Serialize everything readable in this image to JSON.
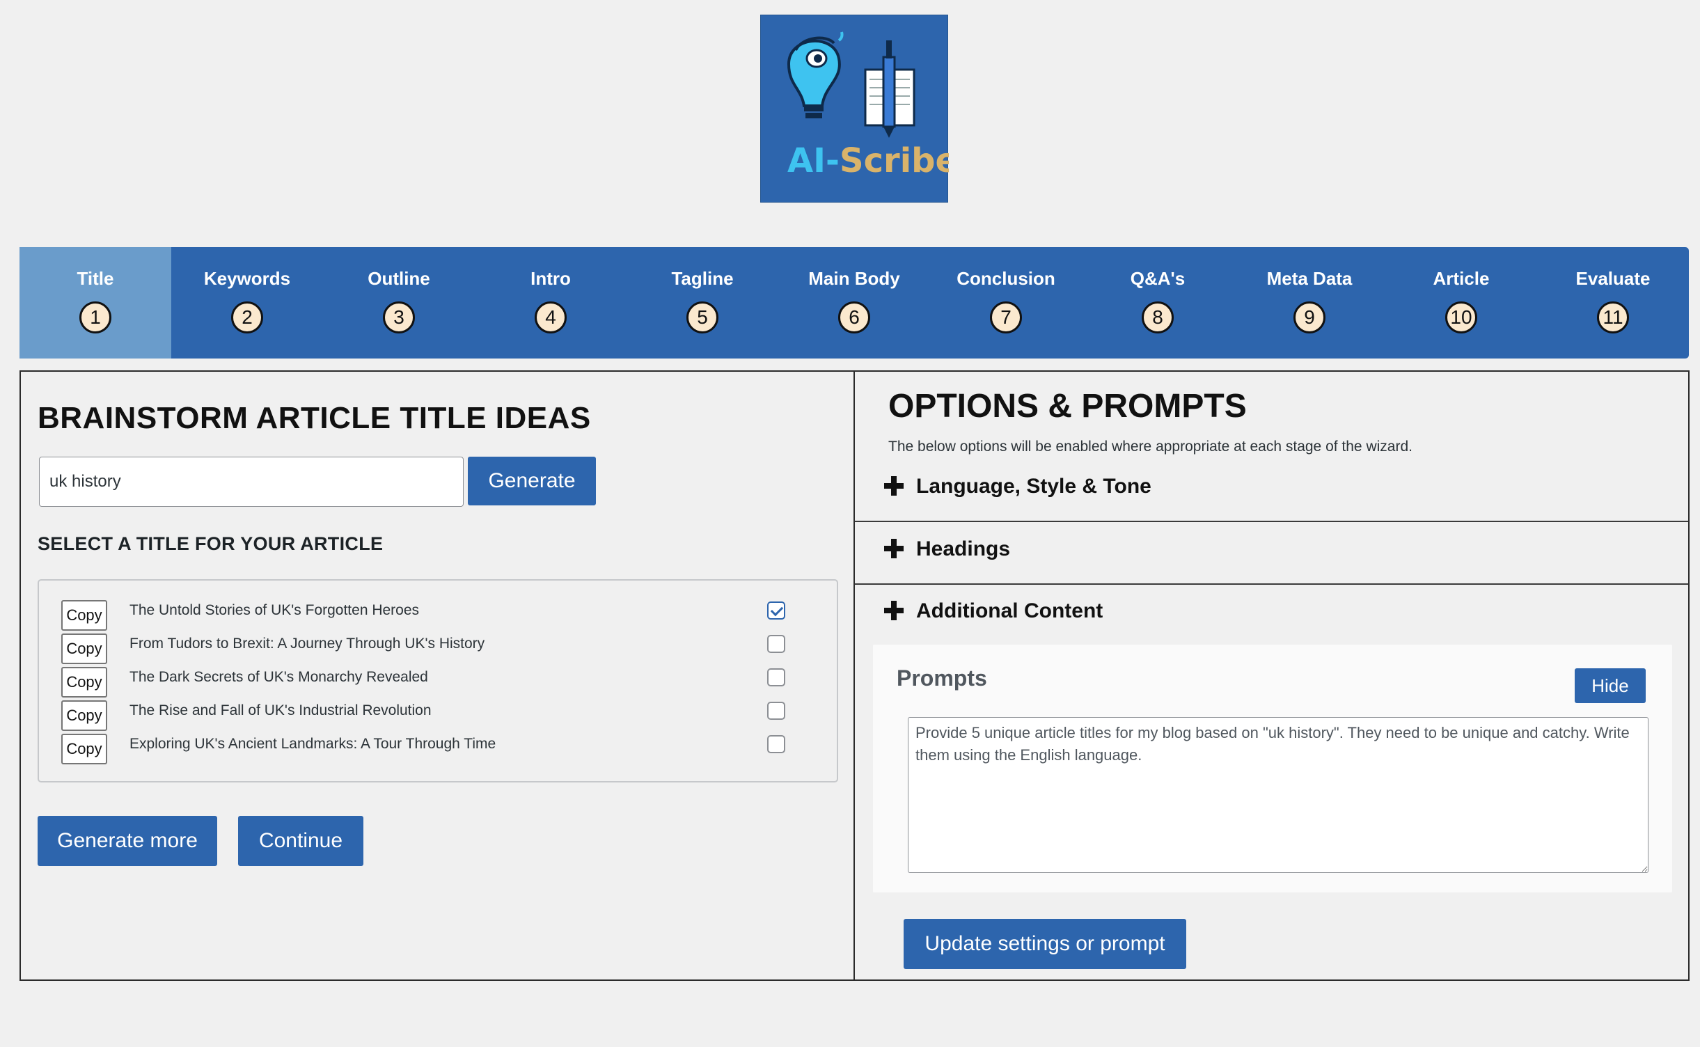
{
  "logo": {
    "text": "AI-Scribe",
    "alt": "AI-Scribe logo"
  },
  "steps": [
    {
      "label": "Title",
      "num": "1",
      "active": true
    },
    {
      "label": "Keywords",
      "num": "2"
    },
    {
      "label": "Outline",
      "num": "3"
    },
    {
      "label": "Intro",
      "num": "4"
    },
    {
      "label": "Tagline",
      "num": "5"
    },
    {
      "label": "Main Body",
      "num": "6"
    },
    {
      "label": "Conclusion",
      "num": "7"
    },
    {
      "label": "Q&A's",
      "num": "8"
    },
    {
      "label": "Meta Data",
      "num": "9"
    },
    {
      "label": "Article",
      "num": "10"
    },
    {
      "label": "Evaluate",
      "num": "11"
    }
  ],
  "brainstorm": {
    "heading": "BRAINSTORM ARTICLE TITLE IDEAS",
    "topic_value": "uk history",
    "generate_label": "Generate",
    "select_heading": "SELECT A TITLE FOR YOUR ARTICLE",
    "copy_label": "Copy",
    "titles": [
      {
        "text": "The Untold Stories of UK's Forgotten Heroes",
        "checked": true
      },
      {
        "text": "From Tudors to Brexit: A Journey Through UK's History",
        "checked": false
      },
      {
        "text": "The Dark Secrets of UK's Monarchy Revealed",
        "checked": false
      },
      {
        "text": "The Rise and Fall of UK's Industrial Revolution",
        "checked": false
      },
      {
        "text": "Exploring UK's Ancient Landmarks: A Tour Through Time",
        "checked": false
      }
    ],
    "generate_more_label": "Generate more",
    "continue_label": "Continue"
  },
  "options": {
    "heading": "OPTIONS & PROMPTS",
    "description": "The below options will be enabled where appropriate at each stage of the wizard.",
    "sections": [
      "Language, Style & Tone",
      "Headings",
      "Additional Content"
    ],
    "prompts_title": "Prompts",
    "hide_label": "Hide",
    "prompt_text": "Provide 5 unique article titles for my blog based on \"uk history\". They need to be unique and catchy. Write them using the English language.",
    "update_label": "Update settings or prompt"
  },
  "colors": {
    "primary": "#2d65ad",
    "active_step": "#6a9ccb",
    "step_circle": "#fbe9cf",
    "background": "#f0f0f0"
  }
}
